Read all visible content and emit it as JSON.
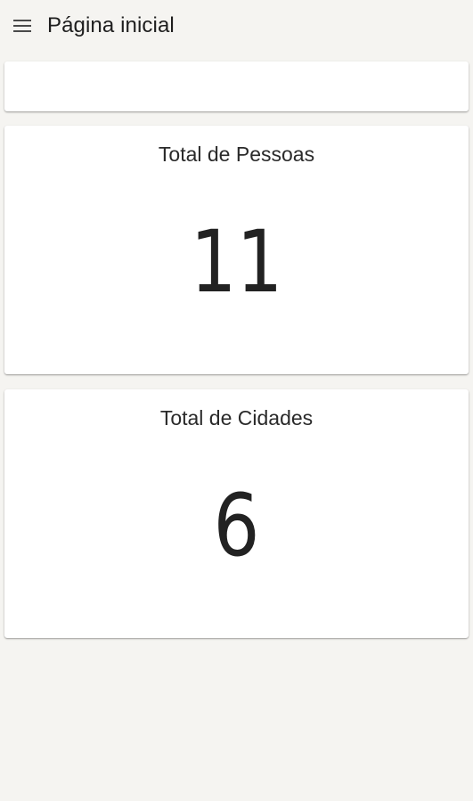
{
  "header": {
    "menu_icon": "menu-icon",
    "title": "Página inicial"
  },
  "cards": [
    {
      "title": "Total de Pessoas",
      "value": "11"
    },
    {
      "title": "Total de Cidades",
      "value": "6"
    }
  ],
  "colors": {
    "background": "#f5f4f1",
    "card": "#ffffff",
    "text": "#222222"
  }
}
